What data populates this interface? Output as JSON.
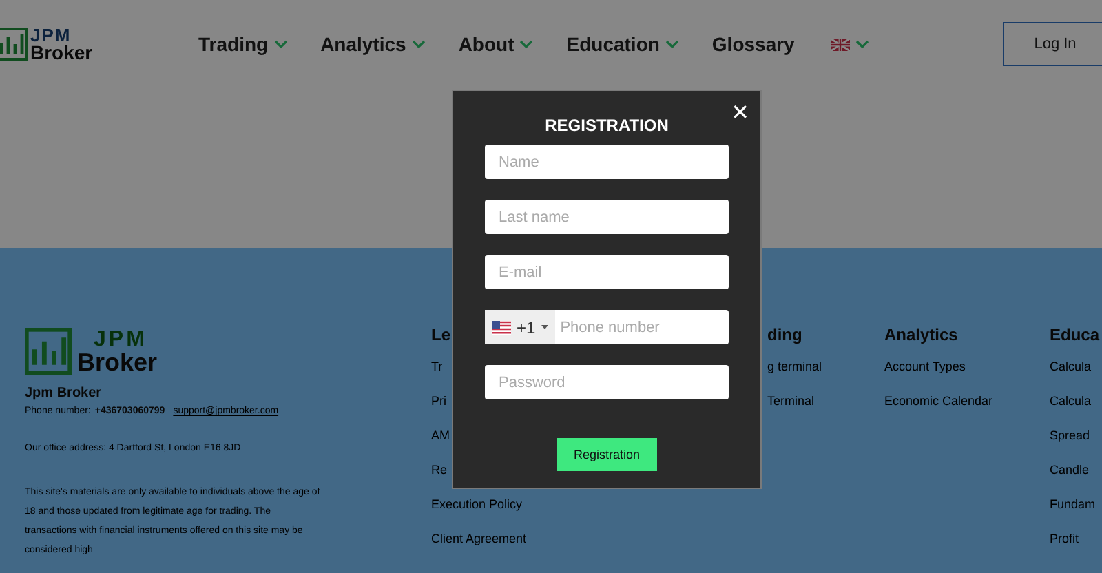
{
  "header": {
    "logo": {
      "line_1": "JPM",
      "line_2": "Broker"
    },
    "nav": [
      {
        "label": "Trading",
        "dropdown": true
      },
      {
        "label": "Analytics",
        "dropdown": true
      },
      {
        "label": "About",
        "dropdown": true
      },
      {
        "label": "Education",
        "dropdown": true
      },
      {
        "label": "Glossary",
        "dropdown": false
      }
    ],
    "language": {
      "dropdown": true
    },
    "login": "Log In"
  },
  "footer": {
    "logo": {
      "line_1": "JPM",
      "line_2": "Broker"
    },
    "company": "Jpm Broker",
    "phone_label": "Phone number:",
    "phone": "+436703060799",
    "email": "support@jpmbroker.com",
    "address": "Our office address: 4 Dartford St, London E16 8JD",
    "disclaimer": "This site's materials are only available to individuals above the age of 18 and those updated from legitimate age for trading. The transactions with financial instruments offered on this site may be considered high",
    "columns": [
      {
        "heading": "Le",
        "links": [
          "Tr",
          "Pri",
          "AM",
          "Re",
          "Execution Policy",
          "Client Agreement"
        ]
      },
      {
        "heading": "ding",
        "links": [
          "g terminal",
          "Terminal"
        ]
      },
      {
        "heading": "Analytics",
        "links": [
          "Account Types",
          "Economic Calendar"
        ]
      },
      {
        "heading": "Educa",
        "links": [
          "Calcula",
          "Calcula",
          "Spread",
          "Candle",
          "Fundam",
          "Profit"
        ]
      }
    ]
  },
  "modal": {
    "title": "REGISTRATION",
    "close": "✕",
    "fields": [
      {
        "kind": "text",
        "placeholder": "Name"
      },
      {
        "kind": "text",
        "placeholder": "Last name"
      },
      {
        "kind": "text",
        "placeholder": "E-mail"
      },
      {
        "kind": "phone",
        "code": "+1",
        "placeholder": "Phone number"
      },
      {
        "kind": "password",
        "placeholder": "Password"
      }
    ],
    "submit": "Registration"
  }
}
